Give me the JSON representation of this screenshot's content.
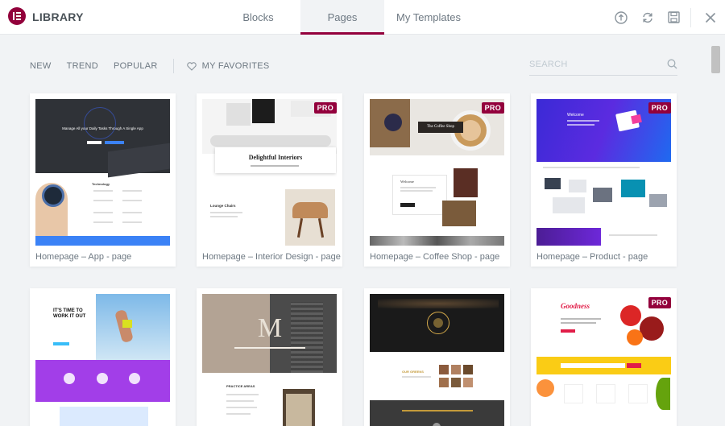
{
  "header": {
    "title": "LIBRARY",
    "tabs": [
      {
        "label": "Blocks",
        "active": false
      },
      {
        "label": "Pages",
        "active": true
      },
      {
        "label": "My Templates",
        "active": false
      }
    ],
    "icons": [
      "upload-icon",
      "sync-icon",
      "save-icon",
      "close-icon"
    ]
  },
  "toolbar": {
    "filters": [
      "NEW",
      "TREND",
      "POPULAR"
    ],
    "favorites_label": "MY FAVORITES",
    "search_placeholder": "SEARCH"
  },
  "templates": [
    {
      "name": "Homepage – App - page",
      "pro": false,
      "hero_text": "Manage All your Daily Tasks Through A Single App",
      "section_text": "Technology"
    },
    {
      "name": "Homepage – Interior Design - page",
      "pro": true,
      "badge": "PRO",
      "hero_text": "Delightful Interiors",
      "section_text": "Lounge Chairs"
    },
    {
      "name": "Homepage – Coffee Shop - page",
      "pro": true,
      "badge": "PRO",
      "hero_text": "The Coffee Shop",
      "section_text": "Welcome"
    },
    {
      "name": "Homepage – Product - page",
      "pro": true,
      "badge": "PRO",
      "hero_text": "Welcome"
    },
    {
      "name": "",
      "pro": false,
      "hero_text": "IT'S TIME TO WORK IT OUT"
    },
    {
      "name": "",
      "pro": false,
      "hero_text": "M",
      "section_text": "PRACTICE AREAS"
    },
    {
      "name": "",
      "pro": false,
      "section_text": "OUR GREENS"
    },
    {
      "name": "",
      "pro": true,
      "badge": "PRO",
      "hero_text": "Goodness"
    }
  ],
  "colors": {
    "accent": "#93003c",
    "background": "#f1f3f5"
  }
}
